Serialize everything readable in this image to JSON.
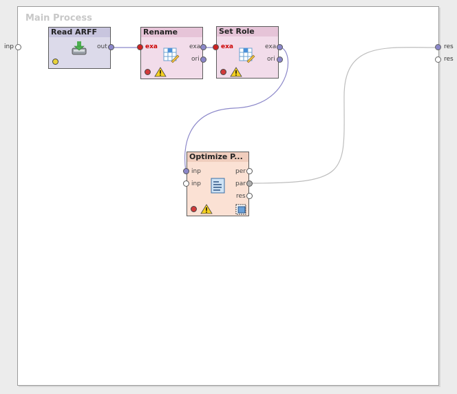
{
  "process": {
    "title": "Main Process"
  },
  "external_ports": {
    "left_inp": "inp",
    "right_res_1": "res",
    "right_res_2": "res"
  },
  "operators": {
    "read_arff": {
      "title": "Read ARFF",
      "ports_out": [
        "out"
      ]
    },
    "rename": {
      "title": "Rename",
      "ports_in": [
        "exa"
      ],
      "ports_out": [
        "exa",
        "ori"
      ]
    },
    "set_role": {
      "title": "Set Role",
      "ports_in": [
        "exa"
      ],
      "ports_out": [
        "exa",
        "ori"
      ]
    },
    "optimize": {
      "title": "Optimize P...",
      "ports_in": [
        "inp",
        "inp"
      ],
      "ports_out": [
        "per",
        "par",
        "res"
      ]
    }
  },
  "colors": {
    "read_arff_bg": "#dcdaea",
    "read_arff_header": "#c8c5de",
    "rename_bg": "#f2dcea",
    "rename_header": "#e6c4d8",
    "optimize_bg": "#fbe1d4",
    "optimize_header": "#f0cdbd",
    "wire_purple": "#8b87c9",
    "wire_gray": "#bdbdbd"
  },
  "icons": {
    "read_arff": "database-import-icon",
    "rename": "table-edit-icon",
    "set_role": "table-edit-icon",
    "optimize": "document-list-icon",
    "status_error": "red-status-icon",
    "status_warning": "warning-icon",
    "status_ok": "yellow-status-icon",
    "subprocess": "subprocess-icon"
  }
}
